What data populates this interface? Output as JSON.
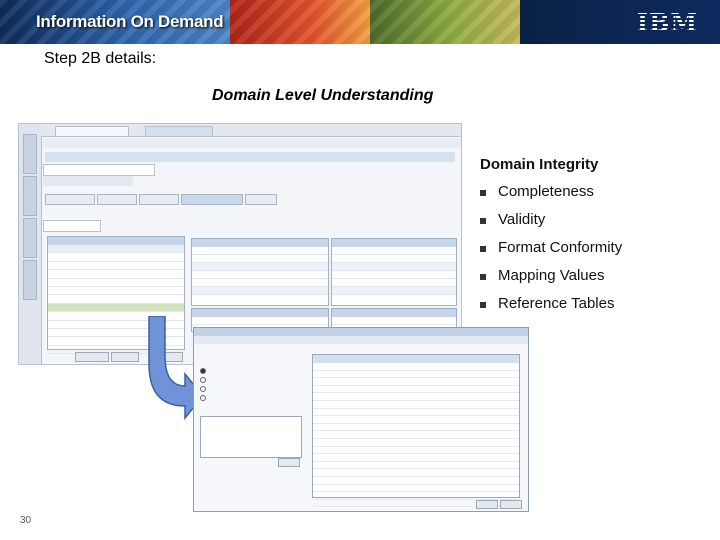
{
  "header": {
    "logo_text": "Information On Demand",
    "brand": "IBM"
  },
  "slide": {
    "title": "Step 2B details:",
    "subtitle": "Domain Level Understanding",
    "page_number": "30"
  },
  "domain_integrity": {
    "heading": "Domain Integrity",
    "items": [
      "Completeness",
      "Validity",
      "Format Conformity",
      "Mapping Values",
      "Reference Tables"
    ]
  },
  "colors": {
    "banner_blue": "#1c3f7a",
    "arrow_blue": "#6f93d6",
    "selected_row": "#cfe3c0"
  }
}
